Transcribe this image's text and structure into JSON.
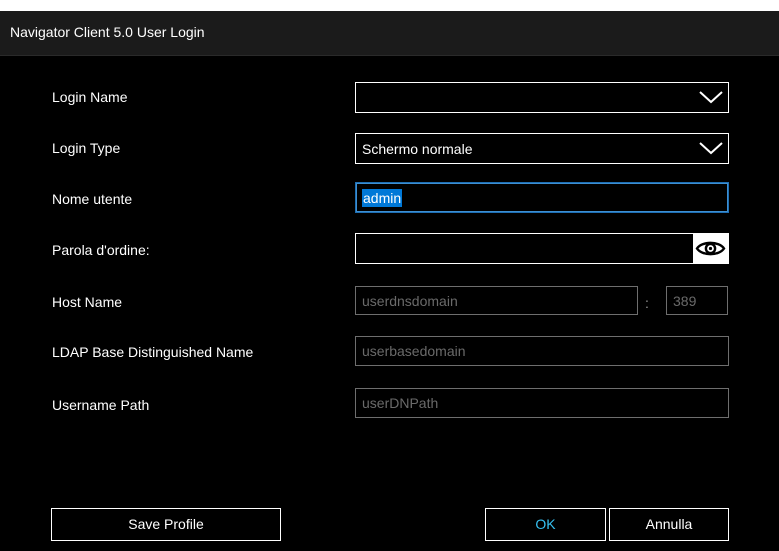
{
  "window": {
    "title": "Navigator Client 5.0 User Login"
  },
  "form": {
    "login_name": {
      "label": "Login Name",
      "value": ""
    },
    "login_type": {
      "label": "Login Type",
      "value": "Schermo normale"
    },
    "username": {
      "label": "Nome utente",
      "value": "admin"
    },
    "password": {
      "label": "Parola d'ordine:",
      "value": "",
      "reveal_icon": "eye-icon"
    },
    "host_name": {
      "label": "Host Name",
      "placeholder": "userdnsdomain",
      "port_placeholder": "389",
      "separator": ":"
    },
    "ldap_base_dn": {
      "label": "LDAP Base Distinguished Name",
      "placeholder": "userbasedomain"
    },
    "username_path": {
      "label": "Username Path",
      "placeholder": "userDNPath"
    }
  },
  "buttons": {
    "save_profile": "Save Profile",
    "ok": "OK",
    "cancel": "Annulla"
  },
  "colors": {
    "background": "#000000",
    "titlebar": "#1b1b1b",
    "focus_border": "#3d8fd1",
    "selection": "#0078d7",
    "ok_text": "#36c0f0",
    "placeholder": "#6a6a6a"
  }
}
